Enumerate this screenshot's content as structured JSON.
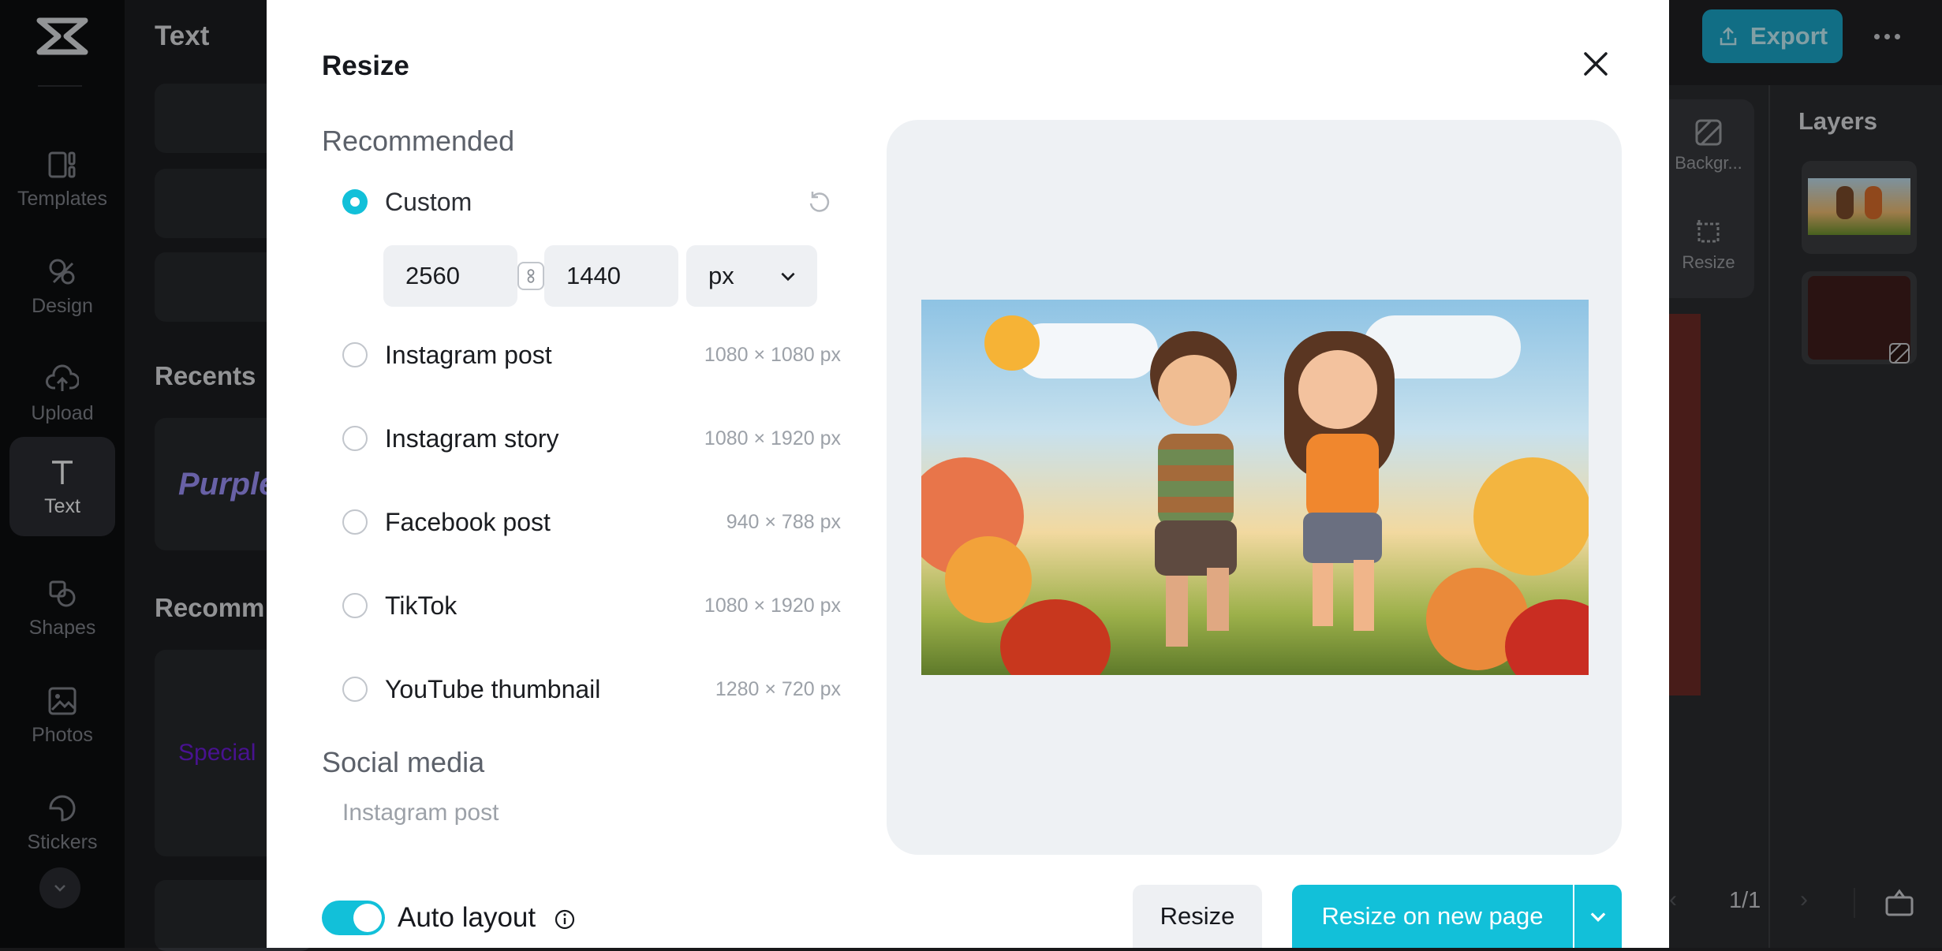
{
  "rail": {
    "items": [
      {
        "label": "Templates",
        "icon": "templates-icon"
      },
      {
        "label": "Design",
        "icon": "design-icon"
      },
      {
        "label": "Upload",
        "icon": "upload-icon"
      },
      {
        "label": "Text",
        "icon": "text-icon",
        "active": true
      },
      {
        "label": "Shapes",
        "icon": "shapes-icon"
      },
      {
        "label": "Photos",
        "icon": "photos-icon"
      },
      {
        "label": "Stickers",
        "icon": "stickers-icon"
      }
    ]
  },
  "panel": {
    "title": "Text",
    "recents_title": "Recents",
    "recommended_title": "Recomm",
    "sample_purple": "Purple",
    "sample_special": "Special"
  },
  "topbar": {
    "export_label": "Export"
  },
  "tools": {
    "background_label": "Backgr...",
    "resize_label": "Resize"
  },
  "layers": {
    "title": "Layers"
  },
  "pager": {
    "page": "1/1"
  },
  "dialog": {
    "title": "Resize",
    "recommended_heading": "Recommended",
    "custom_label": "Custom",
    "width": "2560",
    "height": "1440",
    "unit": "px",
    "options": [
      {
        "label": "Instagram post",
        "dims": "1080 × 1080 px"
      },
      {
        "label": "Instagram story",
        "dims": "1080 × 1920 px"
      },
      {
        "label": "Facebook post",
        "dims": "940 × 788 px"
      },
      {
        "label": "TikTok",
        "dims": "1080 × 1920 px"
      },
      {
        "label": "YouTube thumbnail",
        "dims": "1280 × 720 px"
      }
    ],
    "social_heading": "Social media",
    "social_first": "Instagram post",
    "auto_layout_label": "Auto layout",
    "auto_layout_on": true,
    "resize_button": "Resize",
    "resize_new_button": "Resize on new page"
  },
  "colors": {
    "accent": "#12c0d9",
    "export_bg": "#1aa3c4"
  }
}
